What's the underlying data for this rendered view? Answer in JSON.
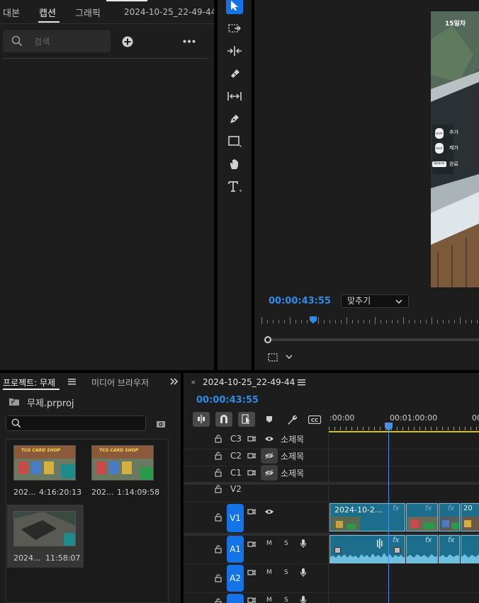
{
  "captions_panel": {
    "tabs": [
      "대본",
      "캡션",
      "그래픽",
      "2024-10-25_22-49-44"
    ],
    "active_tab": "캡션",
    "search_placeholder": "검색"
  },
  "program_monitor": {
    "timecode": "00:00:43:55",
    "fit_dropdown": "맞추기",
    "frame_overlay": {
      "day_label": "15일차",
      "hints": [
        {
          "key": "Hold",
          "text": "추가"
        },
        {
          "key": "Hold",
          "text": "제거"
        },
        {
          "key": "Space",
          "text": "완료"
        }
      ]
    }
  },
  "project_panel": {
    "tabs": [
      "프로젝트: 무제",
      "미디어 브라우저"
    ],
    "project_file": "무제.prproj",
    "items": [
      {
        "name": "202...",
        "duration": "4:16:20:13",
        "thumb_text": "TCG CARD SHOP"
      },
      {
        "name": "202...",
        "duration": "1:14:09:58",
        "thumb_text": "TCG CARD SHOP"
      },
      {
        "name": "2024...",
        "duration": "11:58:07",
        "thumb_text": ""
      }
    ]
  },
  "timeline": {
    "sequence_name": "2024-10-25_22-49-44",
    "timecode": "00:00:43:55",
    "ruler_labels": [
      ":00:00",
      "00:01:00:00",
      "00"
    ],
    "tracks": [
      {
        "id": "C3",
        "name": "소제목"
      },
      {
        "id": "C2",
        "name": "소제목"
      },
      {
        "id": "C1",
        "name": "소제목"
      },
      {
        "id": "V2",
        "name": ""
      },
      {
        "id": "V1",
        "name": ""
      },
      {
        "id": "A1",
        "name": ""
      },
      {
        "id": "A2",
        "name": ""
      }
    ],
    "clip_label": "2024-10-2...",
    "fx_label": "fx",
    "audio_controls": {
      "mute": "M",
      "solo": "S"
    }
  },
  "colors": {
    "accent": "#1473e6",
    "timecode": "#2d8ceb",
    "clip": "#1d6e8c",
    "playhead": "#4a90e2"
  }
}
